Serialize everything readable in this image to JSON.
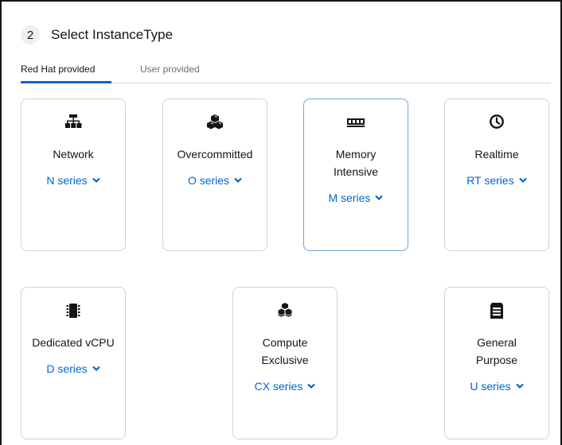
{
  "step": {
    "number": "2",
    "title": "Select InstanceType"
  },
  "tabs": [
    {
      "label": "Red Hat provided",
      "active": true
    },
    {
      "label": "User provided",
      "active": false
    }
  ],
  "cards": [
    {
      "title": "Network",
      "series": "N series",
      "icon": "network-icon",
      "selected": false
    },
    {
      "title": "Overcommitted",
      "series": "O series",
      "icon": "cubes-icon",
      "selected": false
    },
    {
      "title": "Memory Intensive",
      "series": "M series",
      "icon": "memory-icon",
      "selected": true
    },
    {
      "title": "Realtime",
      "series": "RT series",
      "icon": "clock-icon",
      "selected": false
    },
    {
      "title": "Dedicated vCPU",
      "series": "D series",
      "icon": "microchip-icon",
      "selected": false
    },
    {
      "title": "Compute Exclusive",
      "series": "CX series",
      "icon": "stacked-cubes-icon",
      "selected": false
    },
    {
      "title": "General Purpose",
      "series": "U series",
      "icon": "server-icon",
      "selected": false
    }
  ],
  "colors": {
    "accent": "#0066cc",
    "selected_border": "#73a5d8",
    "card_border": "#d2d2d2"
  }
}
